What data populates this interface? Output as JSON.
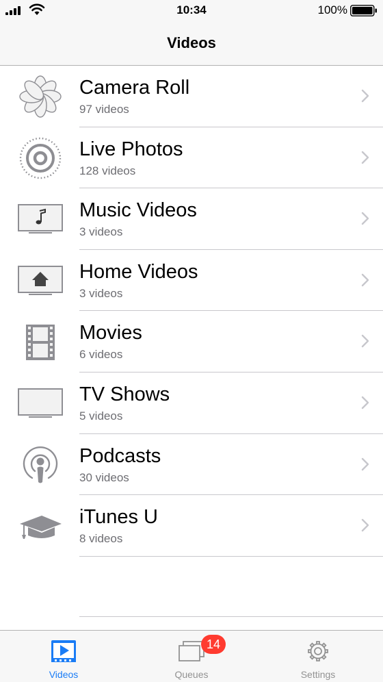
{
  "status_bar": {
    "time": "10:34",
    "battery_percent": "100%"
  },
  "nav": {
    "title": "Videos"
  },
  "list": [
    {
      "title": "Camera Roll",
      "subtitle": "97 videos",
      "icon": "camera-roll-icon"
    },
    {
      "title": "Live Photos",
      "subtitle": "128 videos",
      "icon": "live-photos-icon"
    },
    {
      "title": "Music Videos",
      "subtitle": "3 videos",
      "icon": "music-videos-icon"
    },
    {
      "title": "Home Videos",
      "subtitle": "3 videos",
      "icon": "home-videos-icon"
    },
    {
      "title": "Movies",
      "subtitle": "6 videos",
      "icon": "movies-icon"
    },
    {
      "title": "TV Shows",
      "subtitle": "5 videos",
      "icon": "tv-shows-icon"
    },
    {
      "title": "Podcasts",
      "subtitle": "30 videos",
      "icon": "podcasts-icon"
    },
    {
      "title": "iTunes U",
      "subtitle": "8 videos",
      "icon": "itunes-u-icon"
    }
  ],
  "tabs": [
    {
      "label": "Videos",
      "active": true,
      "icon": "videos-tab-icon"
    },
    {
      "label": "Queues",
      "badge": "14",
      "icon": "queues-tab-icon"
    },
    {
      "label": "Settings",
      "icon": "settings-gear-icon"
    }
  ],
  "colors": {
    "accent": "#1a7cf5",
    "badge": "#ff3b30",
    "icon_gray": "#8e8e93"
  }
}
